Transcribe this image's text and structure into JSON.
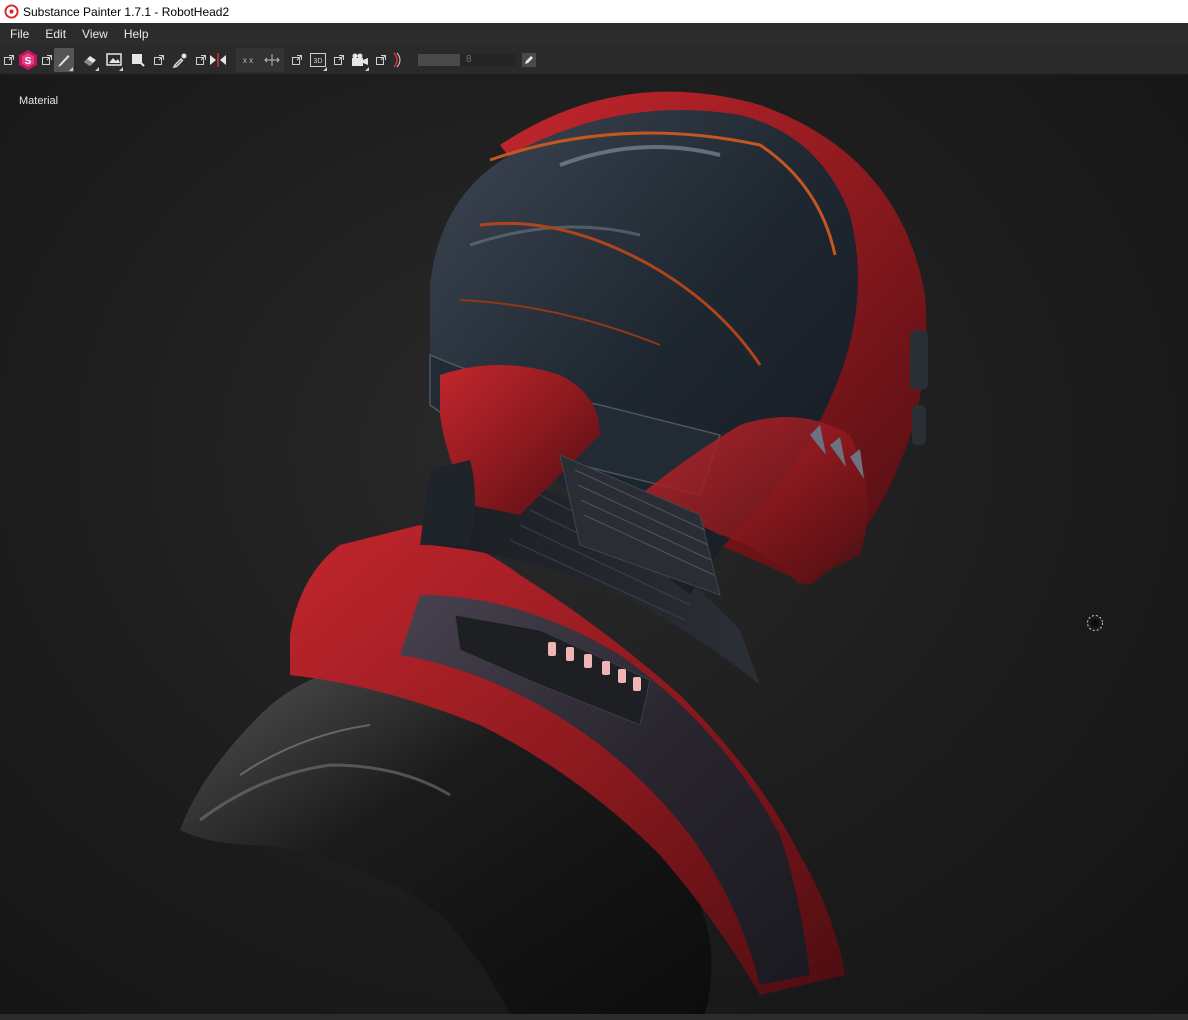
{
  "window": {
    "title": "Substance Painter 1.7.1 - RobotHead2",
    "logo_icon": "substance-painter-logo-icon"
  },
  "menu": {
    "items": [
      "File",
      "Edit",
      "View",
      "Help"
    ]
  },
  "toolbar": {
    "icons": [
      "popout-icon",
      "substance-logo-icon",
      "popout-icon",
      "paint-brush-icon",
      "eraser-icon",
      "projection-icon",
      "polygon-fill-icon",
      "popout-icon",
      "color-picker-icon",
      "popout-icon",
      "symmetry-icon",
      "symmetry-x-icon",
      "symmetry-y-icon",
      "popout-icon",
      "3d-view-icon",
      "popout-icon",
      "camera-icon",
      "popout-icon",
      "lazy-mouse-icon",
      "edit-icon"
    ],
    "brush_size_value": "8"
  },
  "viewport": {
    "channel_label": "Material"
  },
  "colors": {
    "accent": "#c2185b",
    "titlebar_bg": "#ffffff",
    "menubar_bg": "#2c2c2c",
    "toolbar_bg": "#2a2a2a",
    "viewport_bg": "#1c1c1c",
    "helmet_red": "#8e1a1f",
    "helmet_dark": "#1f2731"
  }
}
